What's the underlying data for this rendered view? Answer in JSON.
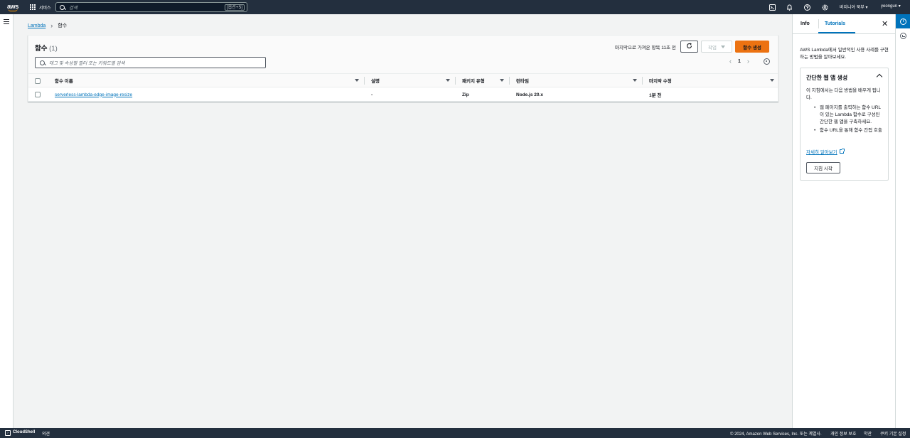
{
  "topnav": {
    "logo_text": "aws",
    "services_label": "서비스",
    "search_placeholder": "검색",
    "search_shortcut": "[옵션+S]",
    "region": "버지니아 북부 ▾",
    "user": "yeongun ▾"
  },
  "breadcrumb": {
    "root": "Lambda",
    "current": "함수"
  },
  "functions_panel": {
    "title": "함수",
    "count": "(1)",
    "last_fetched": "마지막으로 가져온 항목 11초 전",
    "actions_label": "작업",
    "create_label": "함수 생성",
    "filter_placeholder": "태그 및 속성별 필터 또는 키워드별 검색",
    "current_page": "1"
  },
  "table": {
    "headers": [
      "함수 이름",
      "설명",
      "패키지 유형",
      "런타임",
      "마지막 수정"
    ],
    "rows": [
      {
        "name": "serverless-lambda-edge-image-resize",
        "description": "-",
        "package_type": "Zip",
        "runtime": "Node.js 20.x",
        "last_modified": "1분 전"
      }
    ]
  },
  "help_panel": {
    "tab_info": "Info",
    "tab_tutorials": "Tutorials",
    "intro": "AWS Lambda에서 일반적인 사용 사례를 구현하는 방법을 알아보세요.",
    "tutorial_title": "간단한 웹 앱 생성",
    "tutorial_desc": "이 지침에서는 다음 방법을 배우게 됩니다.",
    "tutorial_points": [
      "웹 페이지를 출력하는 함수 URL이 있는 Lambda 함수로 구성된 간단한 웹 앱을 구축하세요.",
      "함수 URL을 통해 함수 간접 호출"
    ],
    "learn_more": "자세히 알아보기",
    "start_label": "지침 시작"
  },
  "footer": {
    "cloudshell": "CloudShell",
    "feedback": "의견",
    "copyright": "© 2024, Amazon Web Services, Inc. 또는 계열사.",
    "privacy": "개인 정보 보호",
    "terms": "약관",
    "cookies": "쿠키 기본 설정"
  },
  "colors": {
    "nav_bg": "#232f3e",
    "accent": "#0073bb",
    "primary_button": "#ec7211"
  }
}
